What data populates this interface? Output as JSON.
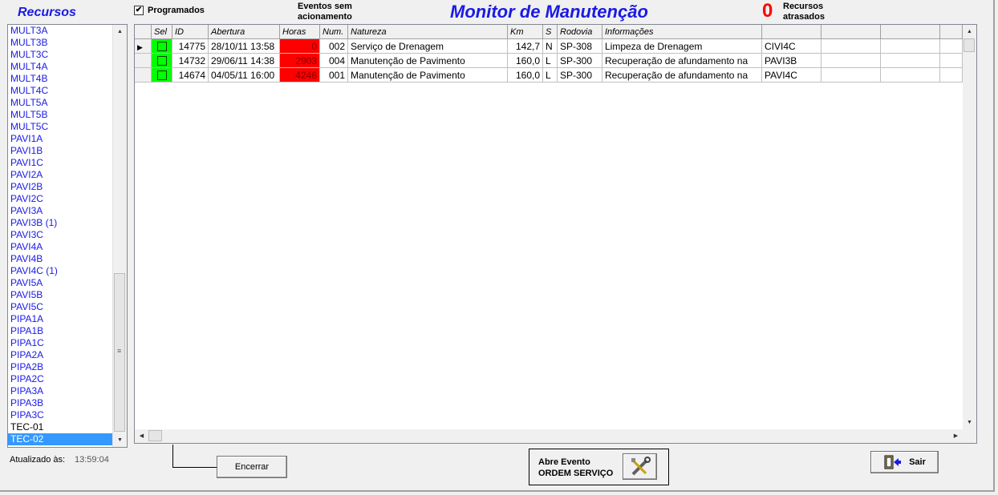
{
  "sidebar": {
    "title": "Recursos",
    "items": [
      {
        "label": "MULT3A",
        "style": "blue"
      },
      {
        "label": "MULT3B",
        "style": "blue"
      },
      {
        "label": "MULT3C",
        "style": "blue"
      },
      {
        "label": "MULT4A",
        "style": "blue"
      },
      {
        "label": "MULT4B",
        "style": "blue"
      },
      {
        "label": "MULT4C",
        "style": "blue"
      },
      {
        "label": "MULT5A",
        "style": "blue"
      },
      {
        "label": "MULT5B",
        "style": "blue"
      },
      {
        "label": "MULT5C",
        "style": "blue"
      },
      {
        "label": "PAVI1A",
        "style": "blue"
      },
      {
        "label": "PAVI1B",
        "style": "blue"
      },
      {
        "label": "PAVI1C",
        "style": "blue"
      },
      {
        "label": "PAVI2A",
        "style": "blue"
      },
      {
        "label": "PAVI2B",
        "style": "blue"
      },
      {
        "label": "PAVI2C",
        "style": "blue"
      },
      {
        "label": "PAVI3A",
        "style": "blue"
      },
      {
        "label": "PAVI3B  (1)",
        "style": "blue"
      },
      {
        "label": "PAVI3C",
        "style": "blue"
      },
      {
        "label": "PAVI4A",
        "style": "blue"
      },
      {
        "label": "PAVI4B",
        "style": "blue"
      },
      {
        "label": "PAVI4C  (1)",
        "style": "blue"
      },
      {
        "label": "PAVI5A",
        "style": "blue"
      },
      {
        "label": "PAVI5B",
        "style": "blue"
      },
      {
        "label": "PAVI5C",
        "style": "blue"
      },
      {
        "label": "PIPA1A",
        "style": "blue"
      },
      {
        "label": "PIPA1B",
        "style": "blue"
      },
      {
        "label": "PIPA1C",
        "style": "blue"
      },
      {
        "label": "PIPA2A",
        "style": "blue"
      },
      {
        "label": "PIPA2B",
        "style": "blue"
      },
      {
        "label": "PIPA2C",
        "style": "blue"
      },
      {
        "label": "PIPA3A",
        "style": "blue"
      },
      {
        "label": "PIPA3B",
        "style": "blue"
      },
      {
        "label": "PIPA3C",
        "style": "blue"
      },
      {
        "label": "TEC-01",
        "style": "dark"
      },
      {
        "label": "TEC-02",
        "style": "selected"
      }
    ]
  },
  "header": {
    "programados_label": "Programados",
    "programados_checked": "✔",
    "eventos_line1": "Eventos sem",
    "eventos_line2": "acionamento",
    "title": "Monitor de Manutenção",
    "recursos_atrasados_count": "0",
    "recursos_line1": "Recursos",
    "recursos_line2": "atrasados"
  },
  "grid": {
    "columns": [
      "Sel",
      "ID",
      "Abertura",
      "Horas",
      "Num.",
      "Natureza",
      "Km",
      "S",
      "Rodovia",
      "Informações",
      "",
      "",
      ""
    ],
    "rows": [
      {
        "id": "14775",
        "abertura": "28/10/11 13:58",
        "horas": "0",
        "num": "002",
        "natureza": "Serviço de Drenagem",
        "km": "142,7",
        "s": "N",
        "rodovia": "SP-308",
        "info": "Limpeza de Drenagem",
        "recurso": "CIVI4C",
        "active": true
      },
      {
        "id": "14732",
        "abertura": "29/06/11 14:38",
        "horas": "2903",
        "num": "004",
        "natureza": "Manutenção de Pavimento",
        "km": "160,0",
        "s": "L",
        "rodovia": "SP-300",
        "info": "Recuperação de afundamento na",
        "recurso": "PAVI3B",
        "active": false
      },
      {
        "id": "14674",
        "abertura": "04/05/11 16:00",
        "horas": "4246",
        "num": "001",
        "natureza": "Manutenção de Pavimento",
        "km": "160,0",
        "s": "L",
        "rodovia": "SP-300",
        "info": "Recuperação de afundamento na",
        "recurso": "PAVI4C",
        "active": false
      }
    ]
  },
  "footer": {
    "updated_label": "Atualizado às:",
    "updated_time": "13:59:04",
    "encerrar_label": "Encerrar",
    "abre_evento_line1": "Abre Evento",
    "abre_evento_line2": "ORDEM SERVIÇO",
    "sair_label": "Sair"
  },
  "colors": {
    "accent_blue": "#1a1ae6",
    "alert_red": "#ff0000",
    "sel_green": "#00ff00",
    "selection": "#3399ff"
  }
}
